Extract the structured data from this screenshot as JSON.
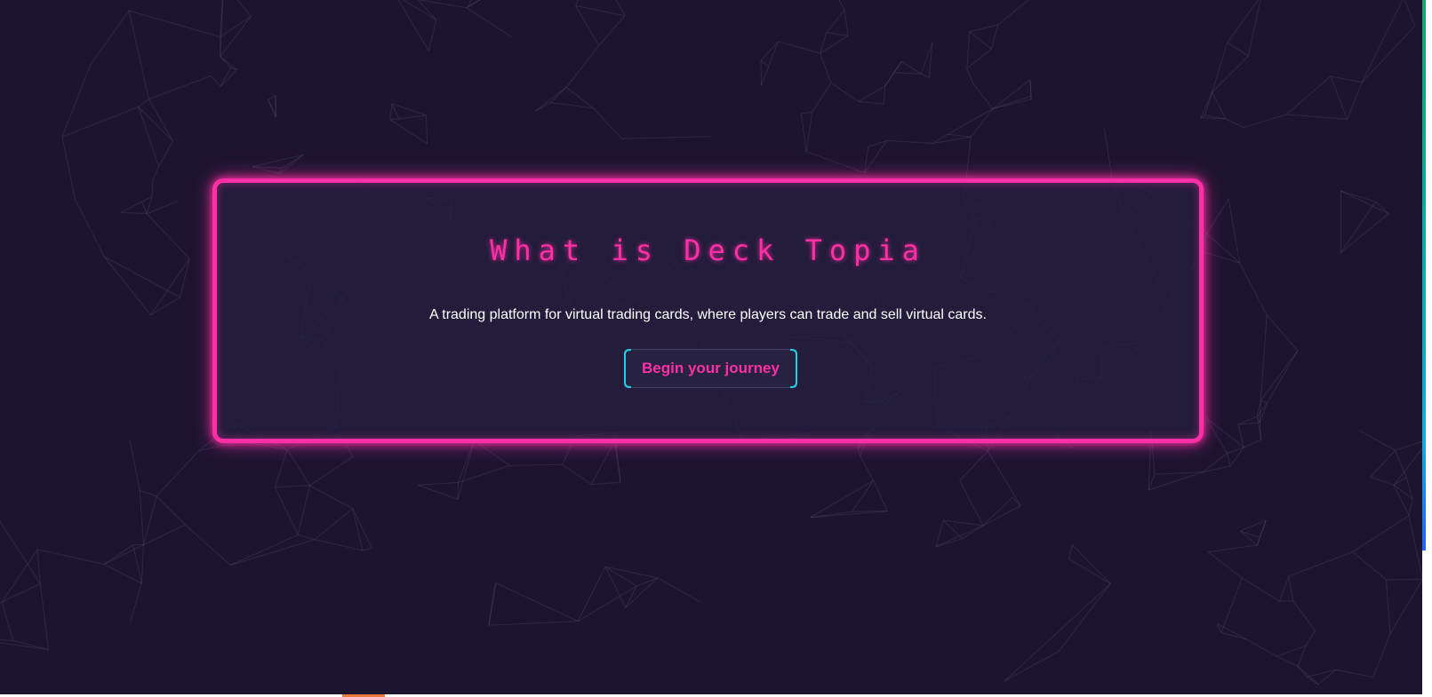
{
  "hero": {
    "title": "What is Deck Topia",
    "description": "A trading platform for virtual trading cards, where players can trade and sell virtual cards.",
    "cta_label": "Begin your journey"
  },
  "colors": {
    "background": "#1d1430",
    "neon_pink": "#ff2fa6",
    "accent_cyan": "#1fd0e8",
    "text": "#ffffff"
  }
}
